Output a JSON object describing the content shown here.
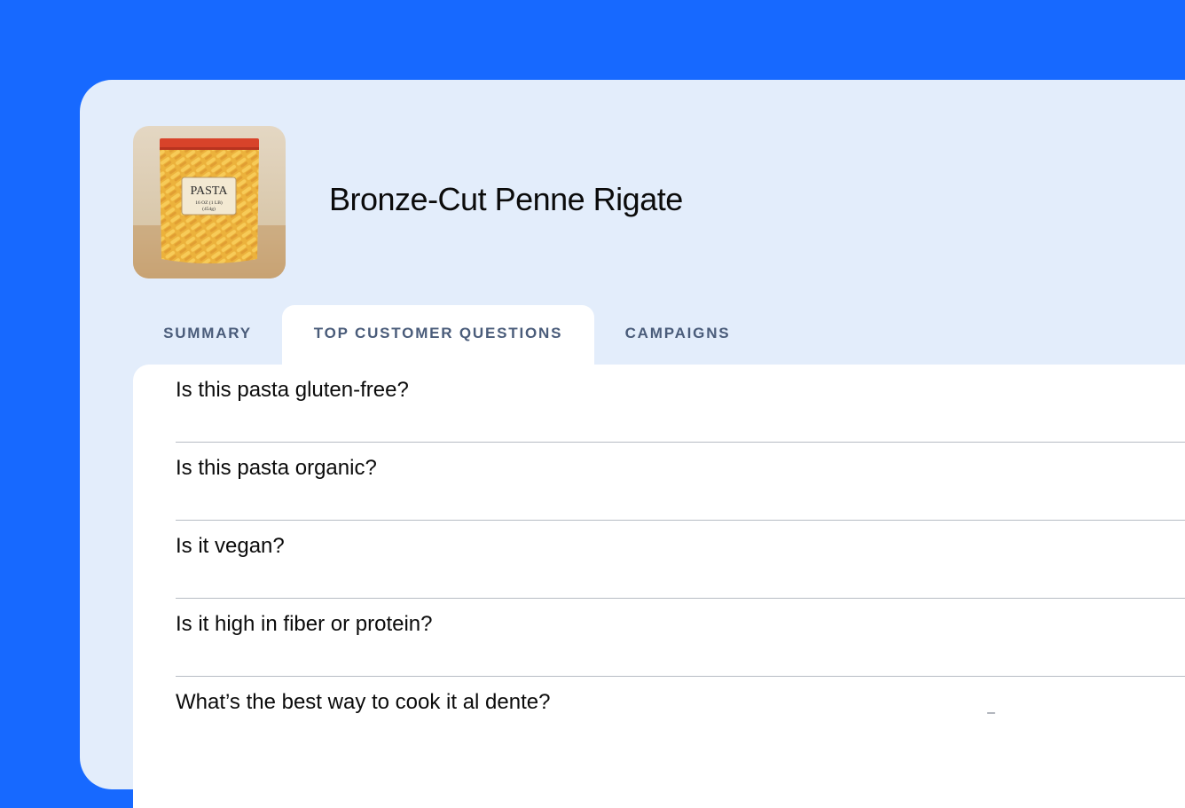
{
  "product": {
    "name": "Bronze-Cut Penne Rigate",
    "image_label": {
      "brand": "PASTA",
      "weight": "16 OZ (1 LB)",
      "grams": "(454g)"
    }
  },
  "tabs": [
    {
      "label": "SUMMARY",
      "active": false
    },
    {
      "label": "TOP CUSTOMER QUESTIONS",
      "active": true
    },
    {
      "label": "CAMPAIGNS",
      "active": false
    }
  ],
  "questions": [
    {
      "text": "Is this pasta gluten-free?"
    },
    {
      "text": "Is this pasta organic?"
    },
    {
      "text": "Is it vegan?"
    },
    {
      "text": "Is it high in fiber or protein?"
    },
    {
      "text": "What’s the best way to cook it al dente?",
      "icon": "–"
    }
  ],
  "colors": {
    "background": "#1769FF",
    "card": "#E3EDFB",
    "tab_text": "#4A5C7A"
  }
}
